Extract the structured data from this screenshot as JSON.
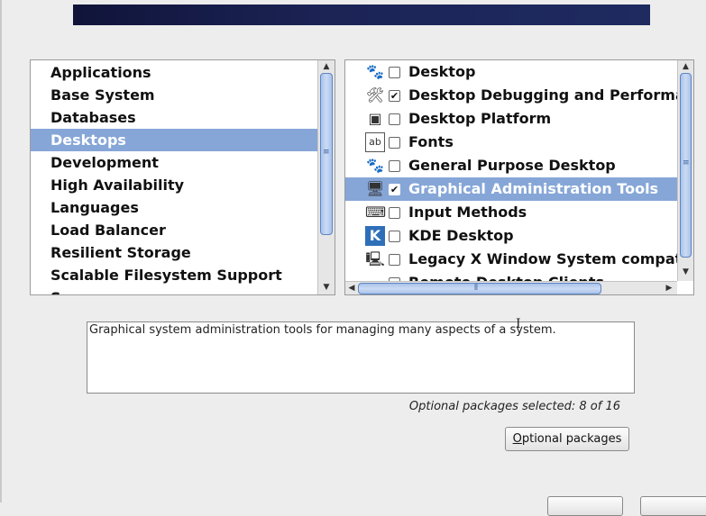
{
  "categories": {
    "items": [
      {
        "label": "Applications",
        "selected": false
      },
      {
        "label": "Base System",
        "selected": false
      },
      {
        "label": "Databases",
        "selected": false
      },
      {
        "label": "Desktops",
        "selected": true
      },
      {
        "label": "Development",
        "selected": false
      },
      {
        "label": "High Availability",
        "selected": false
      },
      {
        "label": "Languages",
        "selected": false
      },
      {
        "label": "Load Balancer",
        "selected": false
      },
      {
        "label": "Resilient Storage",
        "selected": false
      },
      {
        "label": "Scalable Filesystem Support",
        "selected": false
      },
      {
        "label": "Servers",
        "selected": false
      }
    ]
  },
  "groups": {
    "items": [
      {
        "label": "Desktop",
        "checked": false,
        "icon": "gnome-foot-icon",
        "glyph": "🐾",
        "selected": false
      },
      {
        "label": "Desktop Debugging and Performance Tools",
        "checked": true,
        "icon": "tools-icon",
        "glyph": "🛠",
        "selected": false
      },
      {
        "label": "Desktop Platform",
        "checked": false,
        "icon": "desktop-platform-icon",
        "glyph": "▣",
        "selected": false
      },
      {
        "label": "Fonts",
        "checked": false,
        "icon": "fonts-icon",
        "glyph": "ab",
        "selected": false
      },
      {
        "label": "General Purpose Desktop",
        "checked": false,
        "icon": "gnome-foot-icon",
        "glyph": "🐾",
        "selected": false
      },
      {
        "label": "Graphical Administration Tools",
        "checked": true,
        "icon": "admin-tools-icon",
        "glyph": "🖥",
        "selected": true
      },
      {
        "label": "Input Methods",
        "checked": false,
        "icon": "keyboard-icon",
        "glyph": "⌨",
        "selected": false
      },
      {
        "label": "KDE Desktop",
        "checked": false,
        "icon": "kde-icon",
        "glyph": "K",
        "selected": false
      },
      {
        "label": "Legacy X Window System compatibility",
        "checked": false,
        "icon": "monitor-icon",
        "glyph": "🖳",
        "selected": false
      },
      {
        "label": "Remote Desktop Clients",
        "checked": false,
        "icon": "remote-desktop-icon",
        "glyph": "▭",
        "selected": false
      }
    ],
    "checked_mark": "✔"
  },
  "description": "Graphical system administration tools for managing many aspects of a system.",
  "optional_count": "Optional packages selected: 8 of 16",
  "optional_button": {
    "mnemonic": "O",
    "rest": "ptional packages"
  },
  "scroll_glyphs": {
    "up": "▲",
    "down": "▼",
    "left": "◀",
    "right": "▶",
    "vgrip": "≡",
    "hgrip": "⦀"
  },
  "colors": {
    "selection": "#86a6d7",
    "banner": "#1c2456"
  }
}
